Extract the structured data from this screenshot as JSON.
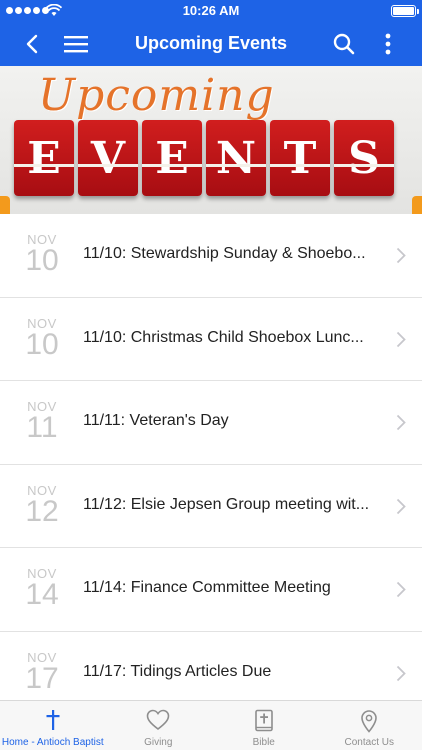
{
  "status_bar": {
    "time": "10:26 AM"
  },
  "nav": {
    "title": "Upcoming Events"
  },
  "banner": {
    "script_word": "Upcoming",
    "letters": [
      "E",
      "V",
      "E",
      "N",
      "T",
      "S"
    ]
  },
  "events": [
    {
      "month": "NOV",
      "day": "10",
      "title": "11/10: Stewardship Sunday & Shoebo..."
    },
    {
      "month": "NOV",
      "day": "10",
      "title": "11/10: Christmas Child Shoebox Lunc..."
    },
    {
      "month": "NOV",
      "day": "11",
      "title": "11/11: Veteran's Day"
    },
    {
      "month": "NOV",
      "day": "12",
      "title": "11/12: Elsie Jepsen Group meeting wit..."
    },
    {
      "month": "NOV",
      "day": "14",
      "title": "11/14: Finance Committee Meeting"
    },
    {
      "month": "NOV",
      "day": "17",
      "title": "11/17: Tidings Articles Due"
    }
  ],
  "tabs": [
    {
      "label": "Home - Antioch Baptist",
      "icon": "cross-icon",
      "active": true
    },
    {
      "label": "Giving",
      "icon": "heart-icon",
      "active": false
    },
    {
      "label": "Bible",
      "icon": "bible-icon",
      "active": false
    },
    {
      "label": "Contact Us",
      "icon": "location-pin-icon",
      "active": false
    }
  ],
  "colors": {
    "primary": "#1e63e6",
    "tab_inactive": "#8e8e8e",
    "date_gray": "#c8c8c8",
    "banner_red": "#c4161c",
    "banner_orange": "#e5732a"
  }
}
